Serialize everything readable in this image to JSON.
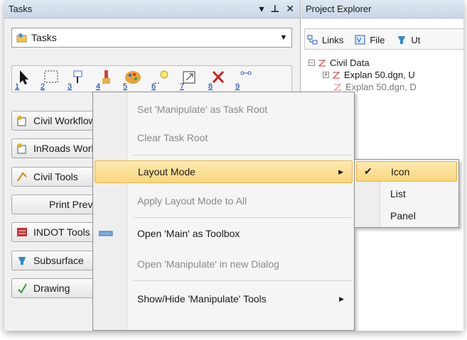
{
  "tasks_panel": {
    "title": "Tasks",
    "dropdown_value": "Tasks",
    "tool_numbers": [
      "1",
      "2",
      "3",
      "4",
      "5",
      "6",
      "7",
      "8",
      "9"
    ],
    "task_buttons": [
      "Civil Workflow",
      "InRoads Workflow",
      "Civil Tools",
      "Print Preview",
      "INDOT Tools",
      "Subsurface",
      "Drawing"
    ]
  },
  "project_explorer": {
    "title": "Project Explorer",
    "tabs": [
      "Links",
      "File",
      "Ut"
    ],
    "tree": {
      "root": "Civil Data",
      "children": [
        "Explan 50.dgn, U",
        "Explan 50.dgn, D"
      ]
    }
  },
  "context_menu": {
    "items": [
      {
        "label": "Set 'Manipulate' as Task Root",
        "disabled": true
      },
      {
        "label": "Clear Task Root",
        "disabled": true
      },
      {
        "label": "Layout Mode",
        "highlighted": true,
        "submenu": true
      },
      {
        "label": "Apply Layout Mode to All",
        "disabled": true
      },
      {
        "label": "Open 'Main' as Toolbox",
        "disabled": false
      },
      {
        "label": "Open 'Manipulate' in new Dialog",
        "disabled": true
      },
      {
        "label": "Show/Hide 'Manipulate' Tools",
        "submenu": true
      }
    ]
  },
  "layout_submenu": {
    "items": [
      {
        "label": "Icon",
        "checked": true
      },
      {
        "label": "List",
        "checked": false
      },
      {
        "label": "Panel",
        "checked": false
      }
    ]
  },
  "colors": {
    "highlight": "#f9d77d",
    "highlight_border": "#e7b54e",
    "header": "#cad7e8"
  }
}
